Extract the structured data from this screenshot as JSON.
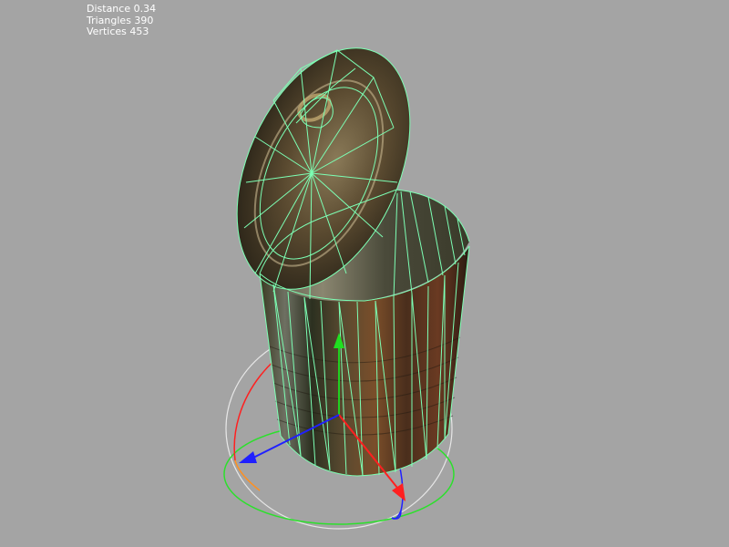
{
  "stats": {
    "distance": "Distance 0.34",
    "triangles": "Triangles 390",
    "vertices": "Vertices 453"
  },
  "colors": {
    "background": "#a4a4a4",
    "wireframe": "#7dffb4",
    "gizmo_x": "#ff2020",
    "gizmo_y": "#20e020",
    "gizmo_z": "#2020ff",
    "gizmo_outer": "#e0e0e0",
    "stats_text": "#ffffff"
  },
  "scene": {
    "model": "tin-can-with-open-lid",
    "render_mode": "textured-with-wireframe-overlay",
    "gizmo": "rotation-gizmo"
  }
}
